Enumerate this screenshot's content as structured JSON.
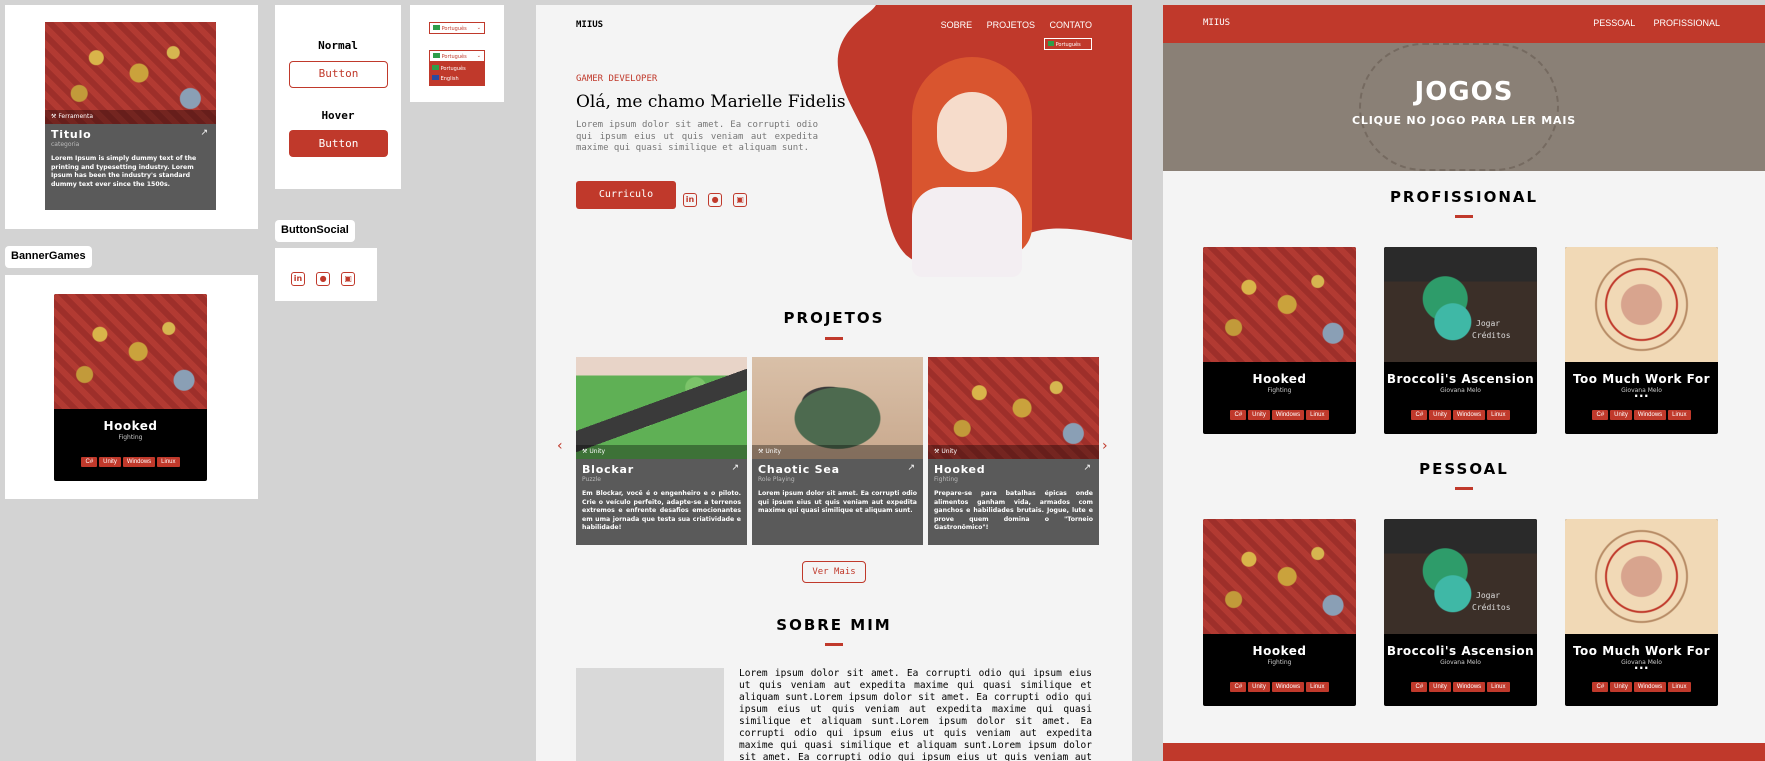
{
  "colors": {
    "accent": "#c0392b",
    "dark": "#000000",
    "card_gray": "#5a5a5a",
    "page_bg": "#f4f4f4"
  },
  "components": {
    "card_label": {
      "tool": "Ferramenta",
      "title": "Titulo",
      "category": "categoria",
      "desc": "Lorem Ipsum is simply dummy text of the printing and typesetting industry. Lorem Ipsum has been the industry's standard dummy text ever since the 1500s."
    },
    "button_states": {
      "normal_label": "Normal",
      "hover_label": "Hover",
      "button_text": "Button"
    },
    "lang": {
      "selected": "Português",
      "options": [
        "Português",
        "English"
      ]
    },
    "banner_games_label": "BannerGames",
    "button_social_label": "ButtonSocial",
    "banner_game": {
      "title": "Hooked",
      "category": "Fighting",
      "tags": [
        "C#",
        "Unity",
        "Windows",
        "Linux"
      ]
    }
  },
  "portfolio": {
    "logo": "MIIUS",
    "nav": [
      "SOBRE",
      "PROJETOS",
      "CONTATO"
    ],
    "lang_selected": "Português",
    "hero": {
      "eyebrow": "GAMER DEVELOPER",
      "headline": "Olá, me chamo Marielle Fidelis",
      "text": "Lorem ipsum dolor sit amet. Ea corrupti odio qui ipsum eius ut quis veniam aut expedita maxime qui quasi similique et aliquam sunt.",
      "cta": "Curriculo"
    },
    "projects": {
      "title": "PROJETOS",
      "cards": [
        {
          "tool": "Unity",
          "title": "Blockar",
          "category": "Puzzle",
          "desc": "Em Blockar, você é o engenheiro e o piloto. Crie o veículo perfeito, adapte-se a terrenos extremos e enfrente desafios emocionantes em uma jornada que testa sua criatividade e habilidade!"
        },
        {
          "tool": "Unity",
          "title": "Chaotic Sea",
          "category": "Role Playing",
          "desc": "Lorem ipsum dolor sit amet. Ea corrupti odio qui ipsum eius ut quis veniam aut expedita maxime qui quasi similique et aliquam sunt."
        },
        {
          "tool": "Unity",
          "title": "Hooked",
          "category": "Fighting",
          "desc": "Prepare-se para batalhas épicas onde alimentos ganham vida, armados com ganchos e habilidades brutais. Jogue, lute e prove quem domina o \"Torneio Gastronômico\"!"
        }
      ],
      "more": "Ver Mais"
    },
    "about": {
      "title": "SOBRE MIM",
      "text": "Lorem ipsum dolor sit amet. Ea corrupti odio qui ipsum eius ut quis veniam aut expedita maxime qui quasi similique et aliquam sunt.Lorem ipsum dolor sit amet. Ea corrupti odio qui ipsum eius ut quis veniam aut expedita maxime qui quasi similique et aliquam sunt.Lorem ipsum dolor sit amet. Ea corrupti odio qui ipsum eius ut quis veniam aut expedita maxime qui quasi similique et aliquam sunt.Lorem ipsum dolor sit amet. Ea corrupti odio qui ipsum eius ut quis veniam aut expedita maxime"
    }
  },
  "games_page": {
    "logo": "MIIUS",
    "nav": [
      "PESSOAL",
      "PROFISSIONAL"
    ],
    "banner_title": "JOGOS",
    "banner_sub": "CLIQUE NO JOGO PARA LER MAIS",
    "professional_title": "PROFISSIONAL",
    "personal_title": "PESSOAL",
    "games": [
      {
        "title": "Hooked",
        "sub": "Fighting",
        "tags": [
          "C#",
          "Unity",
          "Windows",
          "Linux"
        ]
      },
      {
        "title": "Broccoli's Ascension",
        "sub": "Giovana Melo",
        "tags": [
          "C#",
          "Unity",
          "Windows",
          "Linux"
        ],
        "art_text": [
          "Jogar",
          "Créditos"
        ]
      },
      {
        "title": "Too Much Work For ...",
        "sub": "Giovana Melo",
        "tags": [
          "C#",
          "Unity",
          "Windows",
          "Linux"
        ]
      }
    ]
  }
}
